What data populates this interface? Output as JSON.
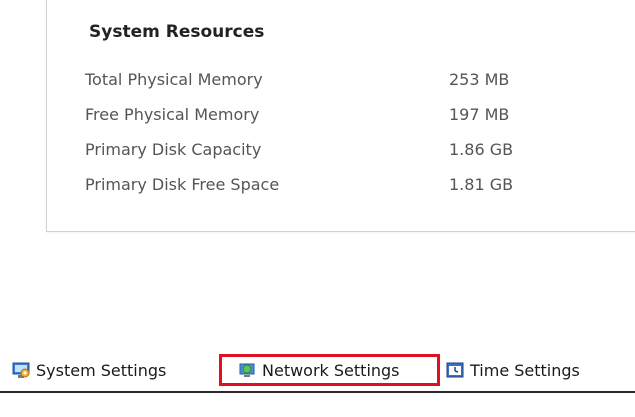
{
  "resources": {
    "title": "System Resources",
    "rows": [
      {
        "label": "Total Physical Memory",
        "value": "253 MB"
      },
      {
        "label": "Free Physical Memory",
        "value": "197 MB"
      },
      {
        "label": "Primary Disk Capacity",
        "value": "1.86 GB"
      },
      {
        "label": "Primary Disk Free Space",
        "value": "1.81 GB"
      }
    ]
  },
  "tabs": [
    {
      "label": "System Settings",
      "icon": "system-settings-icon"
    },
    {
      "label": "Network Settings",
      "icon": "network-globe-icon",
      "highlighted": true,
      "highlight_color": "#e01020"
    },
    {
      "label": "Time Settings",
      "icon": "clock-icon"
    }
  ]
}
